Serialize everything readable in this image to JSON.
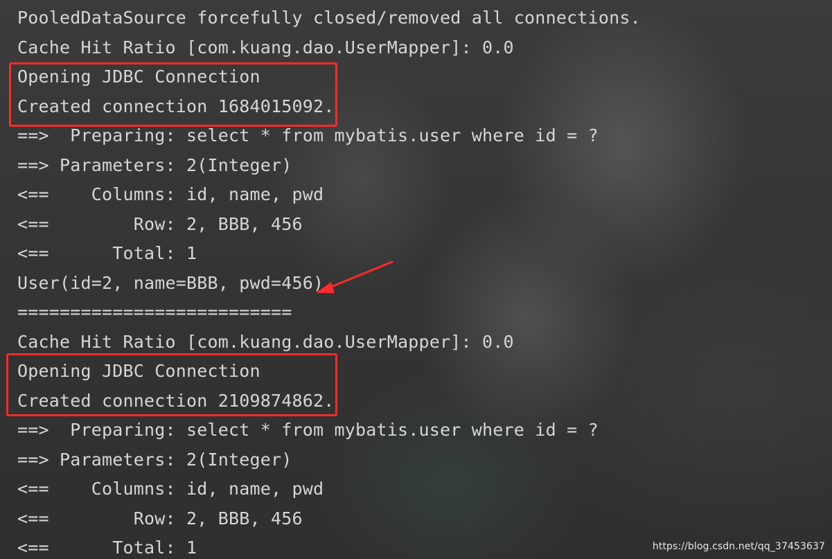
{
  "console": {
    "lines": [
      "PooledDataSource forcefully closed/removed all connections.",
      "Cache Hit Ratio [com.kuang.dao.UserMapper]: 0.0",
      "Opening JDBC Connection",
      "Created connection 1684015092.",
      "==>  Preparing: select * from mybatis.user where id = ?",
      "==> Parameters: 2(Integer)",
      "<==    Columns: id, name, pwd",
      "<==        Row: 2, BBB, 456",
      "<==      Total: 1",
      "User(id=2, name=BBB, pwd=456)",
      "==========================",
      "Cache Hit Ratio [com.kuang.dao.UserMapper]: 0.0",
      "Opening JDBC Connection",
      "Created connection 2109874862.",
      "==>  Preparing: select * from mybatis.user where id = ?",
      "==> Parameters: 2(Integer)",
      "<==    Columns: id, name, pwd",
      "<==        Row: 2, BBB, 456",
      "<==      Total: 1"
    ]
  },
  "watermark": "https://blog.csdn.net/qq_37453637",
  "colors": {
    "annotation": "#ff2a2a",
    "text": "#d6d6d6"
  }
}
